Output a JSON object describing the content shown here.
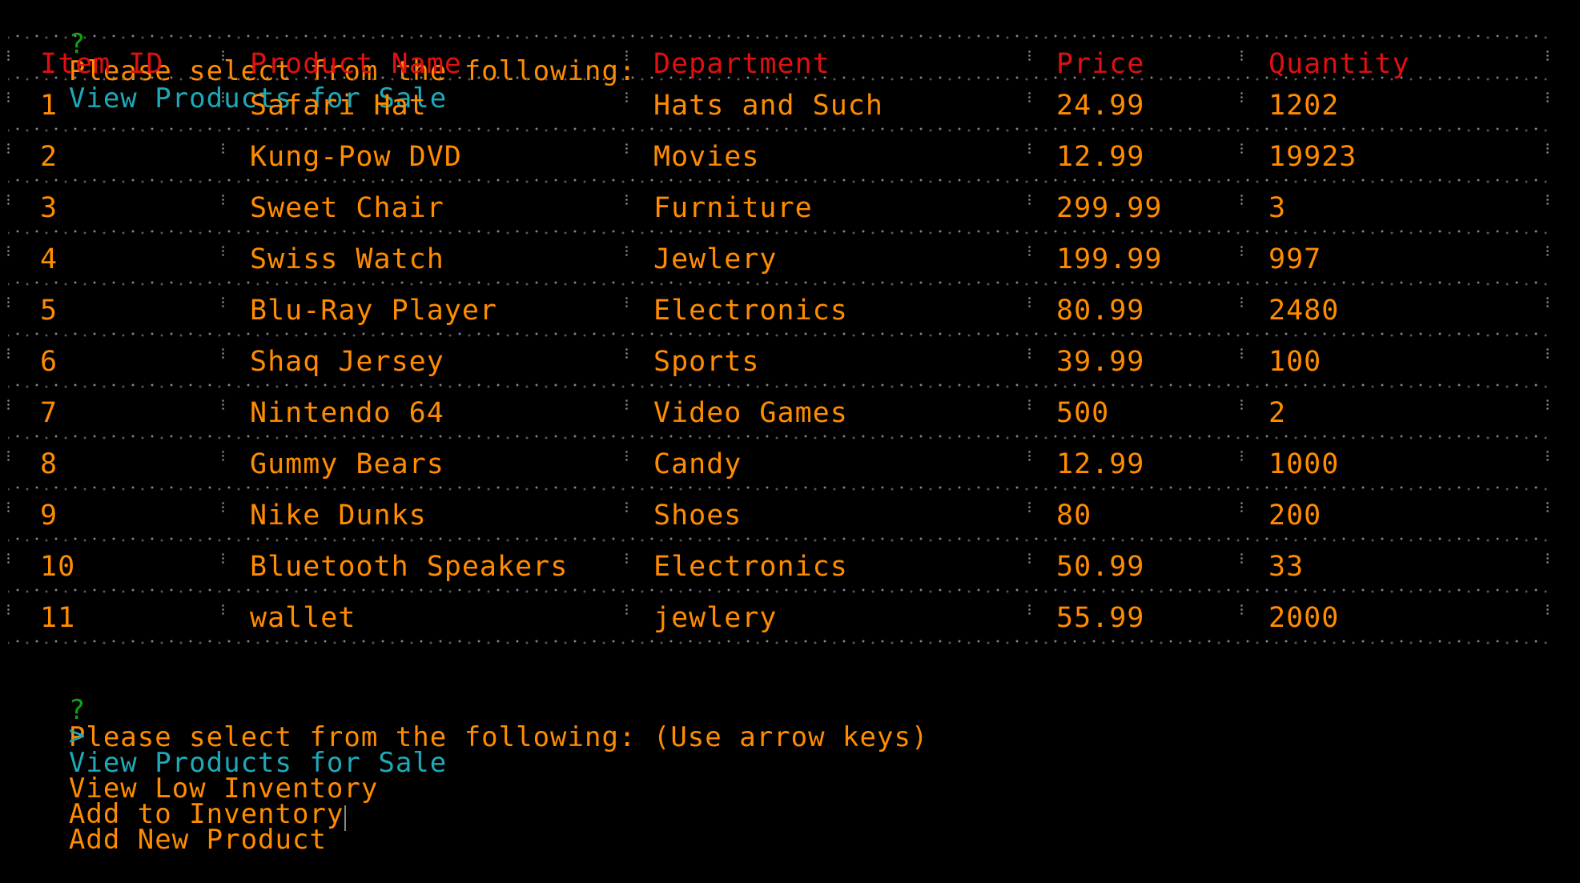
{
  "top_prompt": {
    "mark": "?",
    "text": "Please select from the following:",
    "selection": "View Products for Sale"
  },
  "table": {
    "headers": [
      "Item ID",
      "Product Name",
      "Department",
      "Price",
      "Quantity"
    ],
    "rows": [
      [
        "1",
        "Safari Hat",
        "Hats and Such",
        "24.99",
        "1202"
      ],
      [
        "2",
        "Kung-Pow DVD",
        "Movies",
        "12.99",
        "19923"
      ],
      [
        "3",
        "Sweet Chair",
        "Furniture",
        "299.99",
        "3"
      ],
      [
        "4",
        "Swiss Watch",
        "Jewlery",
        "199.99",
        "997"
      ],
      [
        "5",
        "Blu-Ray Player",
        "Electronics",
        "80.99",
        "2480"
      ],
      [
        "6",
        "Shaq Jersey",
        "Sports",
        "39.99",
        "100"
      ],
      [
        "7",
        "Nintendo 64",
        "Video Games",
        "500",
        "2"
      ],
      [
        "8",
        "Gummy Bears",
        "Candy",
        "12.99",
        "1000"
      ],
      [
        "9",
        "Nike Dunks",
        "Shoes",
        "80",
        "200"
      ],
      [
        "10",
        "Bluetooth Speakers",
        "Electronics",
        "50.99",
        "33"
      ],
      [
        "11",
        "wallet",
        "jewlery",
        "55.99",
        "2000"
      ]
    ]
  },
  "bottom_prompt": {
    "mark": "?",
    "text": "Please select from the following: (Use arrow keys)",
    "pointer": ">",
    "options": [
      "View Products for Sale",
      "View Low Inventory",
      "Add to Inventory",
      "Add New Product"
    ]
  },
  "colors": {
    "background": "#000000",
    "prompt_mark": "#12a112",
    "cyan": "#1ea9b8",
    "orange": "#ff8c00",
    "red": "#e01010",
    "dots": "#8c8c8c"
  }
}
